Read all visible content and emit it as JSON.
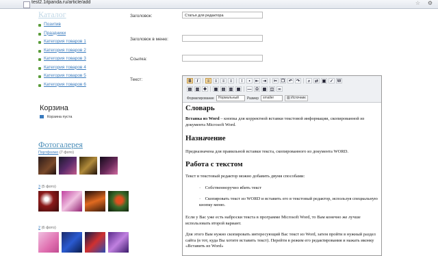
{
  "browser": {
    "url": "test2.1itpanda.ru/article/add"
  },
  "sidebar": {
    "catalog_title": "Каталог",
    "categories": [
      "Позитив",
      "Праздники",
      "Категория товаров 1",
      "Категория товаров 2",
      "Категория товаров 3",
      "Категория товаров 4",
      "Категория товаров 5",
      "Категория товаров 6"
    ],
    "cart_title": "Корзина",
    "cart_text": "Корзина пуста",
    "gallery_title": "Фотогалерея",
    "galleries": [
      {
        "name": "Портфолио",
        "count": "(7 фото)"
      },
      {
        "name": "3",
        "count": "(5 фото)"
      },
      {
        "name": "2",
        "count": "(6 фото)"
      }
    ]
  },
  "form": {
    "title_label": "Заголовок:",
    "title_value": "Статья для редактора",
    "menu_title_label": "Заголовок в меню:",
    "menu_title_value": "",
    "link_label": "Ссылка:",
    "link_value": "",
    "text_label": "Текст:"
  },
  "toolbar": {
    "format_label": "Форматирование",
    "format_value": "Нормальный",
    "size_label": "Размер",
    "size_value": "smaller",
    "source_label": "Источник"
  },
  "editor": {
    "h1": "Словарь",
    "p1_bold": "Вставка из Word",
    "p1_rest": " – кнопка для корректной вставки текстовой информации, скопированной из документа Microsoft Word.",
    "h2": "Назначение",
    "p2": "Предназначена для правильной вставки текста, скопированного из документа WORD.",
    "h3": "Работа с текстом",
    "p3": "Текст в текстовый редактор можно добавить двумя способами:",
    "li1": "Собственноручно вбить текст",
    "li2": "Скопировать текст из WORD и вставить его в текстовый редактор, используя специальную кнопку меню.",
    "p4": "Если у Вас уже есть наброски текста в программе Microsoft Word, то Вам конечно же лучше использовать второй вариант.",
    "p5": "Для этого Вам нужно скопировать интересующий Вас текст из Word, затем пройти в нужный раздел сайта (в тот, куда Вы хотите вставить текст). Перейти в режим его редактирования и нажать иконку «Вставить из Word»"
  },
  "icons": [
    "favicon-icon",
    "star-icon",
    "wrench-icon",
    "bullet-icon",
    "cart-icon",
    "bold-icon",
    "italic-icon",
    "underline-icon",
    "align-left-icon",
    "align-center-icon",
    "align-right-icon",
    "justify-icon",
    "ordered-list-icon",
    "bullet-list-icon",
    "outdent-icon",
    "indent-icon",
    "undo-icon",
    "redo-icon",
    "find-icon",
    "replace-icon",
    "select-all-icon",
    "paste-icon",
    "paste-word-icon",
    "image-icon",
    "link-icon",
    "unlink-icon",
    "table-icon",
    "source-icon"
  ]
}
